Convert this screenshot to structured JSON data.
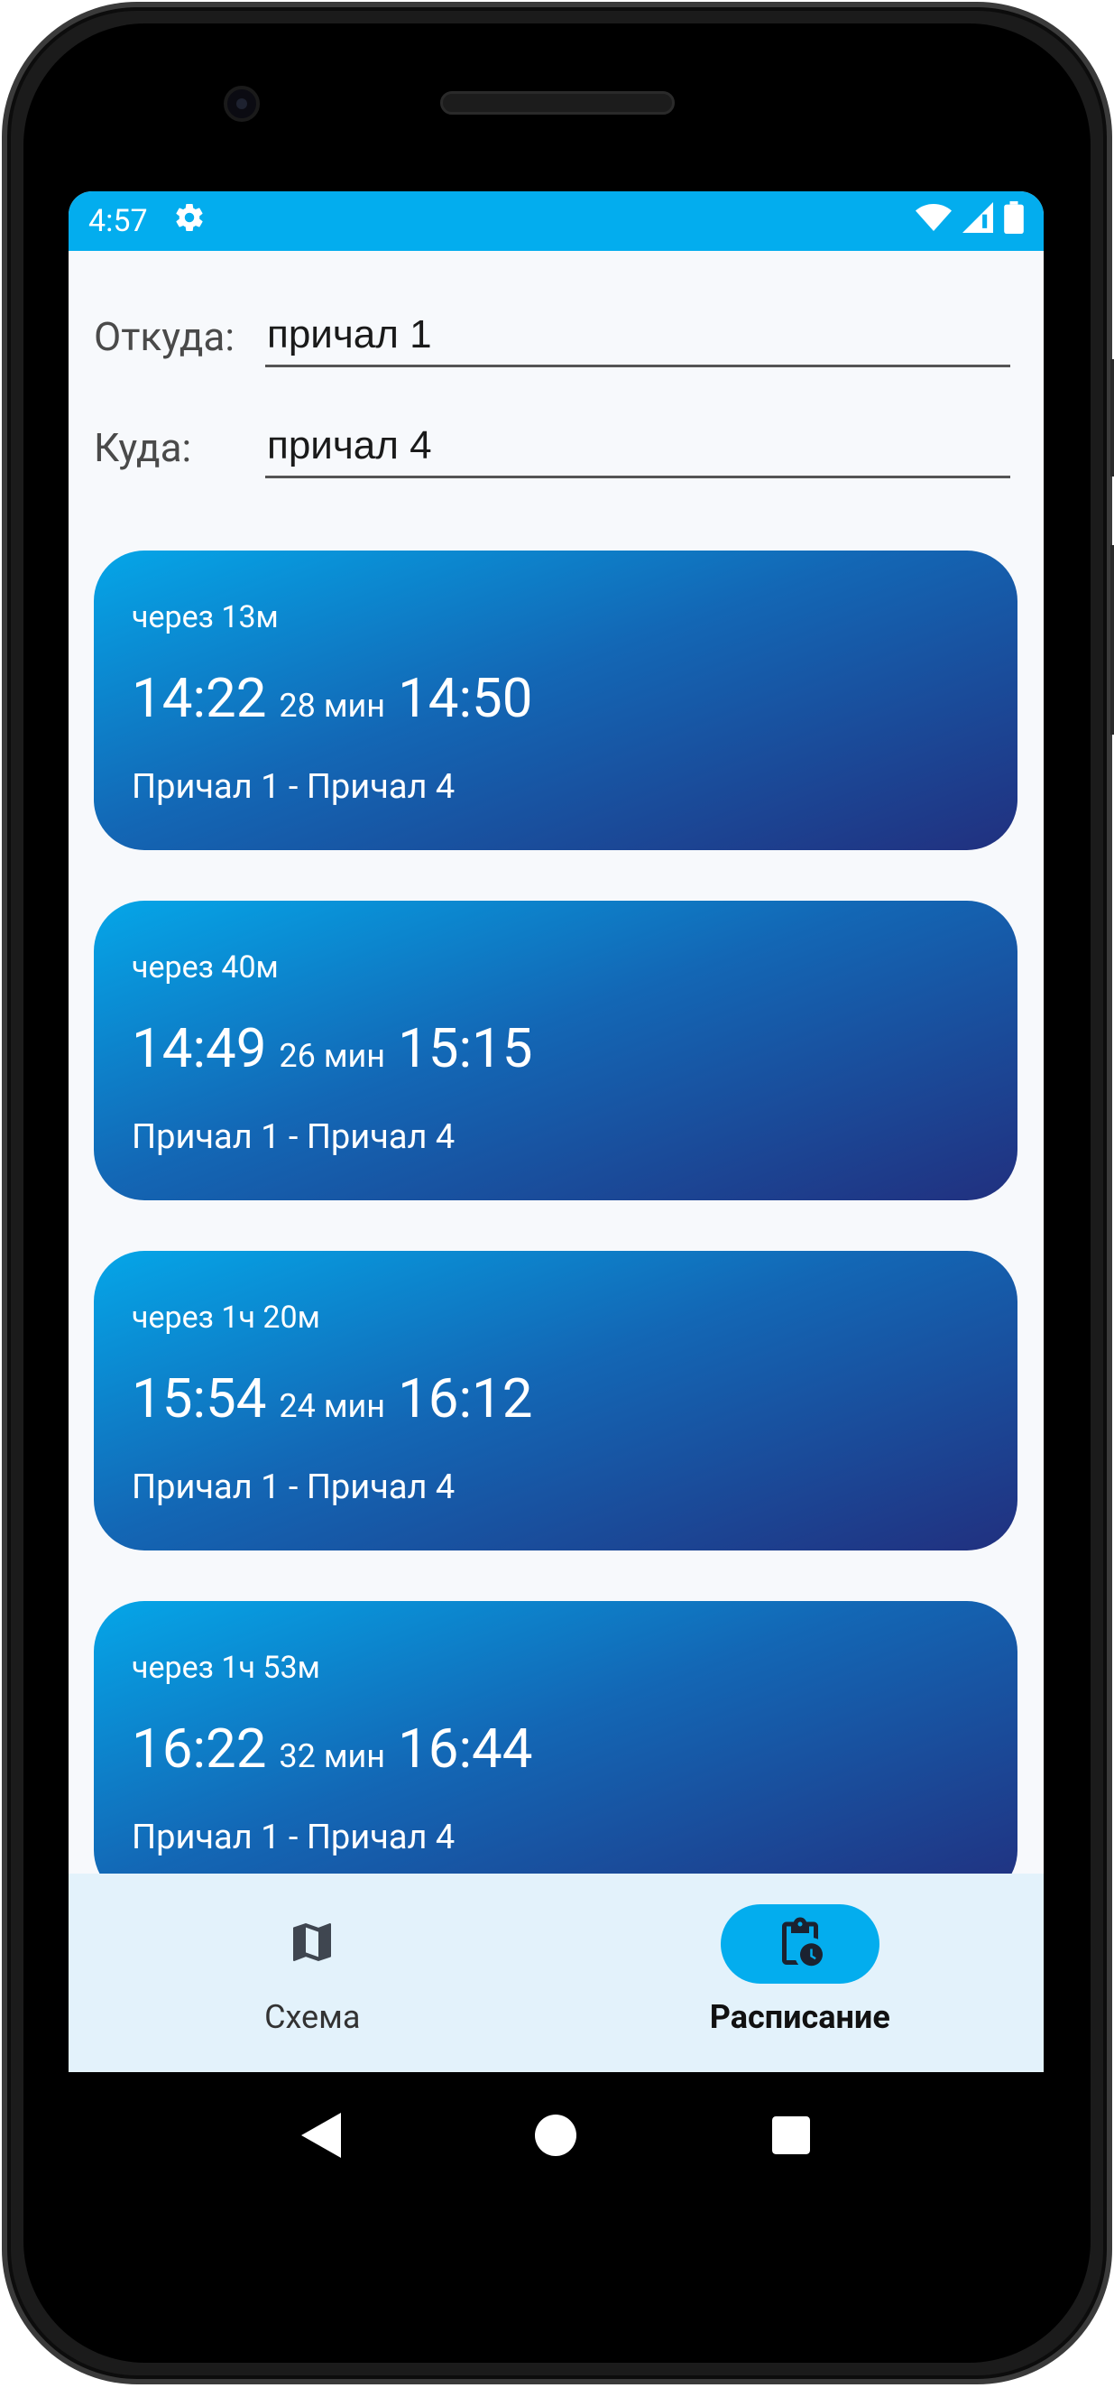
{
  "status_bar": {
    "time": "4:57",
    "icons": [
      "gear-icon",
      "wifi-icon",
      "signal-icon",
      "battery-icon"
    ]
  },
  "route": {
    "from_label": "Откуда:",
    "from_value": "причал 1",
    "to_label": "Куда:",
    "to_value": "причал 4"
  },
  "trips": [
    {
      "in": "через 13м",
      "depart": "14:22",
      "duration": "28 мин",
      "arrive": "14:50",
      "route": "Причал 1 - Причал 4"
    },
    {
      "in": "через 40м",
      "depart": "14:49",
      "duration": "26 мин",
      "arrive": "15:15",
      "route": "Причал 1 - Причал 4"
    },
    {
      "in": "через 1ч 20м",
      "depart": "15:54",
      "duration": "24 мин",
      "arrive": "16:12",
      "route": "Причал 1 - Причал 4"
    },
    {
      "in": "через 1ч 53м",
      "depart": "16:22",
      "duration": "32 мин",
      "arrive": "16:44",
      "route": "Причал 1 - Причал 4"
    }
  ],
  "bottom_nav": {
    "items": [
      {
        "label": "Схема",
        "icon": "map-icon",
        "active": false
      },
      {
        "label": "Расписание",
        "icon": "schedule-icon",
        "active": true
      }
    ]
  },
  "colors": {
    "status_bar": "#03adee",
    "card_gradient_start": "#05a6e8",
    "card_gradient_end": "#21307f",
    "nav_background": "#e3f2fb",
    "nav_active_pill": "#03adee"
  },
  "system_nav": [
    "back-icon",
    "home-icon",
    "recents-icon"
  ]
}
